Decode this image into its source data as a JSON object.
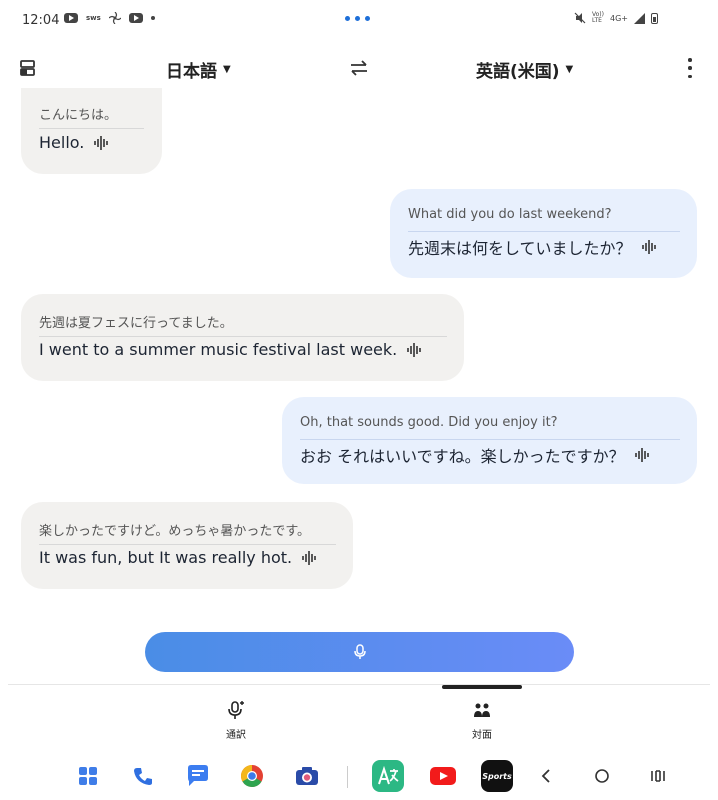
{
  "status_bar": {
    "time": "12:04",
    "mini_text": "sws",
    "network": "4G+",
    "volte": "Vo))\nLTE"
  },
  "toolbar": {
    "source_language": "日本語",
    "target_language": "英語(米国)",
    "caret": "▼"
  },
  "messages": [
    {
      "side": "left",
      "original": "こんにちは。",
      "translation": "Hello."
    },
    {
      "side": "right",
      "original": "What did you do last weekend?",
      "translation": "先週末は何をしていましたか？"
    },
    {
      "side": "left",
      "original": "先週は夏フェスに行ってました。",
      "translation": "I went to a summer music festival last week."
    },
    {
      "side": "right",
      "original": "Oh, that sounds good. Did you enjoy it?",
      "translation": "おお それはいいですね。楽しかったですか？"
    },
    {
      "side": "left",
      "original": "楽しかったですけど。めっちゃ暑かったです。",
      "translation": "It was fun, but It was really hot."
    }
  ],
  "modes": {
    "interpret_label": "通訳",
    "face_to_face_label": "対面"
  },
  "colors": {
    "accent": "#1e6fd9",
    "bubble_left": "#f2f1ef",
    "bubble_right": "#e8f0fd",
    "mic_gradient_start": "#4a8de6",
    "mic_gradient_end": "#6a8cf7"
  },
  "dock": {
    "apps": [
      "apps-grid-icon",
      "phone-icon",
      "messages-icon",
      "chrome-icon",
      "camera-icon",
      "translate-app-icon",
      "youtube-icon",
      "sports-app-icon"
    ],
    "sports_label": "Sports"
  }
}
